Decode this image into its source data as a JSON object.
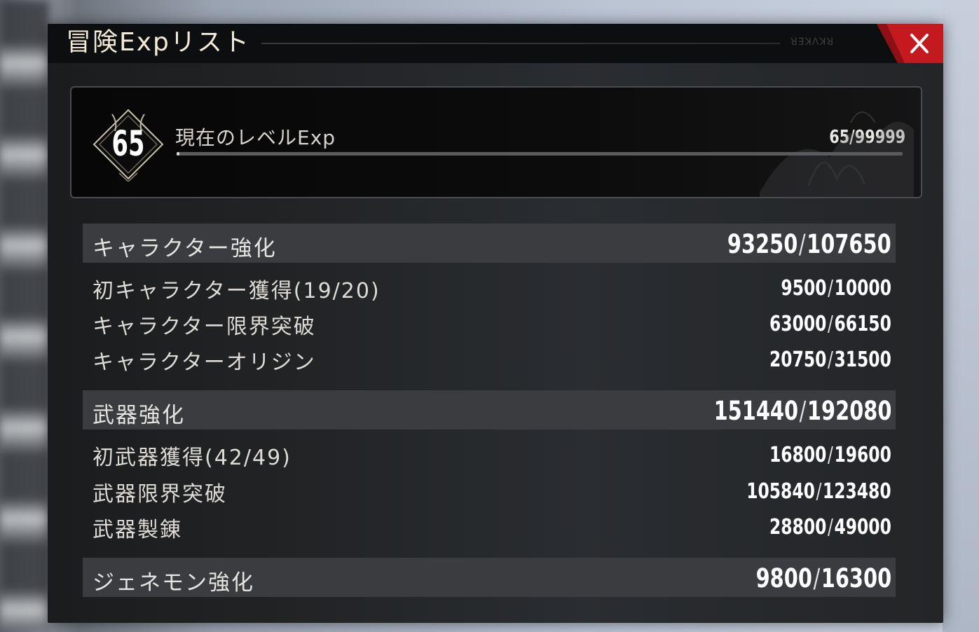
{
  "window": {
    "title": "冒険Expリスト",
    "decoration_text": "ꓤꓱꓘꓥꓘꓤ"
  },
  "level": {
    "current_level": "65",
    "label": "現在のレベルExp",
    "value": "65/99999",
    "progress": 0.00065
  },
  "sections": [
    {
      "title": "キャラクター強化",
      "value": "93250",
      "max": "107650",
      "items": [
        {
          "label": "初キャラクター獲得(19/20)",
          "value": "9500",
          "max": "10000"
        },
        {
          "label": "キャラクター限界突破",
          "value": "63000",
          "max": "66150"
        },
        {
          "label": "キャラクターオリジン",
          "value": "20750",
          "max": "31500"
        }
      ]
    },
    {
      "title": "武器強化",
      "value": "151440",
      "max": "192080",
      "items": [
        {
          "label": "初武器獲得(42/49)",
          "value": "16800",
          "max": "19600"
        },
        {
          "label": "武器限界突破",
          "value": "105840",
          "max": "123480"
        },
        {
          "label": "武器製錬",
          "value": "28800",
          "max": "49000"
        }
      ]
    },
    {
      "title": "ジェネモン強化",
      "value": "9800",
      "max": "16300",
      "items": []
    }
  ],
  "colors": {
    "close_accent": "#c4191e",
    "section_bg": "#3a3c3f",
    "panel_bg": "#222426"
  },
  "icons": {
    "close": "close-icon",
    "level_badge": "level-badge-icon",
    "emblem": "emblem-icon"
  }
}
